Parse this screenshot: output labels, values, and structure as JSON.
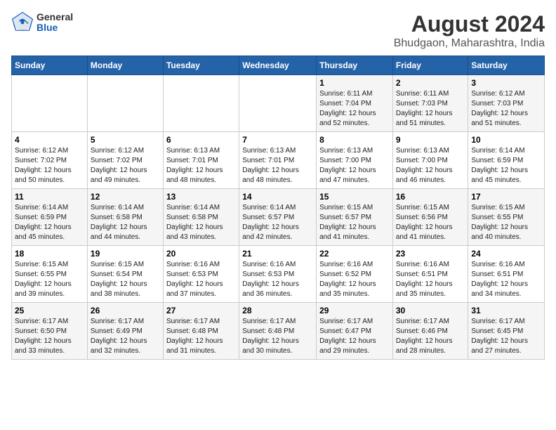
{
  "logo": {
    "general": "General",
    "blue": "Blue"
  },
  "title": "August 2024",
  "subtitle": "Bhudgaon, Maharashtra, India",
  "days_of_week": [
    "Sunday",
    "Monday",
    "Tuesday",
    "Wednesday",
    "Thursday",
    "Friday",
    "Saturday"
  ],
  "weeks": [
    [
      {
        "day": "",
        "info": ""
      },
      {
        "day": "",
        "info": ""
      },
      {
        "day": "",
        "info": ""
      },
      {
        "day": "",
        "info": ""
      },
      {
        "day": "1",
        "info": "Sunrise: 6:11 AM\nSunset: 7:04 PM\nDaylight: 12 hours\nand 52 minutes."
      },
      {
        "day": "2",
        "info": "Sunrise: 6:11 AM\nSunset: 7:03 PM\nDaylight: 12 hours\nand 51 minutes."
      },
      {
        "day": "3",
        "info": "Sunrise: 6:12 AM\nSunset: 7:03 PM\nDaylight: 12 hours\nand 51 minutes."
      }
    ],
    [
      {
        "day": "4",
        "info": "Sunrise: 6:12 AM\nSunset: 7:02 PM\nDaylight: 12 hours\nand 50 minutes."
      },
      {
        "day": "5",
        "info": "Sunrise: 6:12 AM\nSunset: 7:02 PM\nDaylight: 12 hours\nand 49 minutes."
      },
      {
        "day": "6",
        "info": "Sunrise: 6:13 AM\nSunset: 7:01 PM\nDaylight: 12 hours\nand 48 minutes."
      },
      {
        "day": "7",
        "info": "Sunrise: 6:13 AM\nSunset: 7:01 PM\nDaylight: 12 hours\nand 48 minutes."
      },
      {
        "day": "8",
        "info": "Sunrise: 6:13 AM\nSunset: 7:00 PM\nDaylight: 12 hours\nand 47 minutes."
      },
      {
        "day": "9",
        "info": "Sunrise: 6:13 AM\nSunset: 7:00 PM\nDaylight: 12 hours\nand 46 minutes."
      },
      {
        "day": "10",
        "info": "Sunrise: 6:14 AM\nSunset: 6:59 PM\nDaylight: 12 hours\nand 45 minutes."
      }
    ],
    [
      {
        "day": "11",
        "info": "Sunrise: 6:14 AM\nSunset: 6:59 PM\nDaylight: 12 hours\nand 45 minutes."
      },
      {
        "day": "12",
        "info": "Sunrise: 6:14 AM\nSunset: 6:58 PM\nDaylight: 12 hours\nand 44 minutes."
      },
      {
        "day": "13",
        "info": "Sunrise: 6:14 AM\nSunset: 6:58 PM\nDaylight: 12 hours\nand 43 minutes."
      },
      {
        "day": "14",
        "info": "Sunrise: 6:14 AM\nSunset: 6:57 PM\nDaylight: 12 hours\nand 42 minutes."
      },
      {
        "day": "15",
        "info": "Sunrise: 6:15 AM\nSunset: 6:57 PM\nDaylight: 12 hours\nand 41 minutes."
      },
      {
        "day": "16",
        "info": "Sunrise: 6:15 AM\nSunset: 6:56 PM\nDaylight: 12 hours\nand 41 minutes."
      },
      {
        "day": "17",
        "info": "Sunrise: 6:15 AM\nSunset: 6:55 PM\nDaylight: 12 hours\nand 40 minutes."
      }
    ],
    [
      {
        "day": "18",
        "info": "Sunrise: 6:15 AM\nSunset: 6:55 PM\nDaylight: 12 hours\nand 39 minutes."
      },
      {
        "day": "19",
        "info": "Sunrise: 6:15 AM\nSunset: 6:54 PM\nDaylight: 12 hours\nand 38 minutes."
      },
      {
        "day": "20",
        "info": "Sunrise: 6:16 AM\nSunset: 6:53 PM\nDaylight: 12 hours\nand 37 minutes."
      },
      {
        "day": "21",
        "info": "Sunrise: 6:16 AM\nSunset: 6:53 PM\nDaylight: 12 hours\nand 36 minutes."
      },
      {
        "day": "22",
        "info": "Sunrise: 6:16 AM\nSunset: 6:52 PM\nDaylight: 12 hours\nand 35 minutes."
      },
      {
        "day": "23",
        "info": "Sunrise: 6:16 AM\nSunset: 6:51 PM\nDaylight: 12 hours\nand 35 minutes."
      },
      {
        "day": "24",
        "info": "Sunrise: 6:16 AM\nSunset: 6:51 PM\nDaylight: 12 hours\nand 34 minutes."
      }
    ],
    [
      {
        "day": "25",
        "info": "Sunrise: 6:17 AM\nSunset: 6:50 PM\nDaylight: 12 hours\nand 33 minutes."
      },
      {
        "day": "26",
        "info": "Sunrise: 6:17 AM\nSunset: 6:49 PM\nDaylight: 12 hours\nand 32 minutes."
      },
      {
        "day": "27",
        "info": "Sunrise: 6:17 AM\nSunset: 6:48 PM\nDaylight: 12 hours\nand 31 minutes."
      },
      {
        "day": "28",
        "info": "Sunrise: 6:17 AM\nSunset: 6:48 PM\nDaylight: 12 hours\nand 30 minutes."
      },
      {
        "day": "29",
        "info": "Sunrise: 6:17 AM\nSunset: 6:47 PM\nDaylight: 12 hours\nand 29 minutes."
      },
      {
        "day": "30",
        "info": "Sunrise: 6:17 AM\nSunset: 6:46 PM\nDaylight: 12 hours\nand 28 minutes."
      },
      {
        "day": "31",
        "info": "Sunrise: 6:17 AM\nSunset: 6:45 PM\nDaylight: 12 hours\nand 27 minutes."
      }
    ]
  ]
}
